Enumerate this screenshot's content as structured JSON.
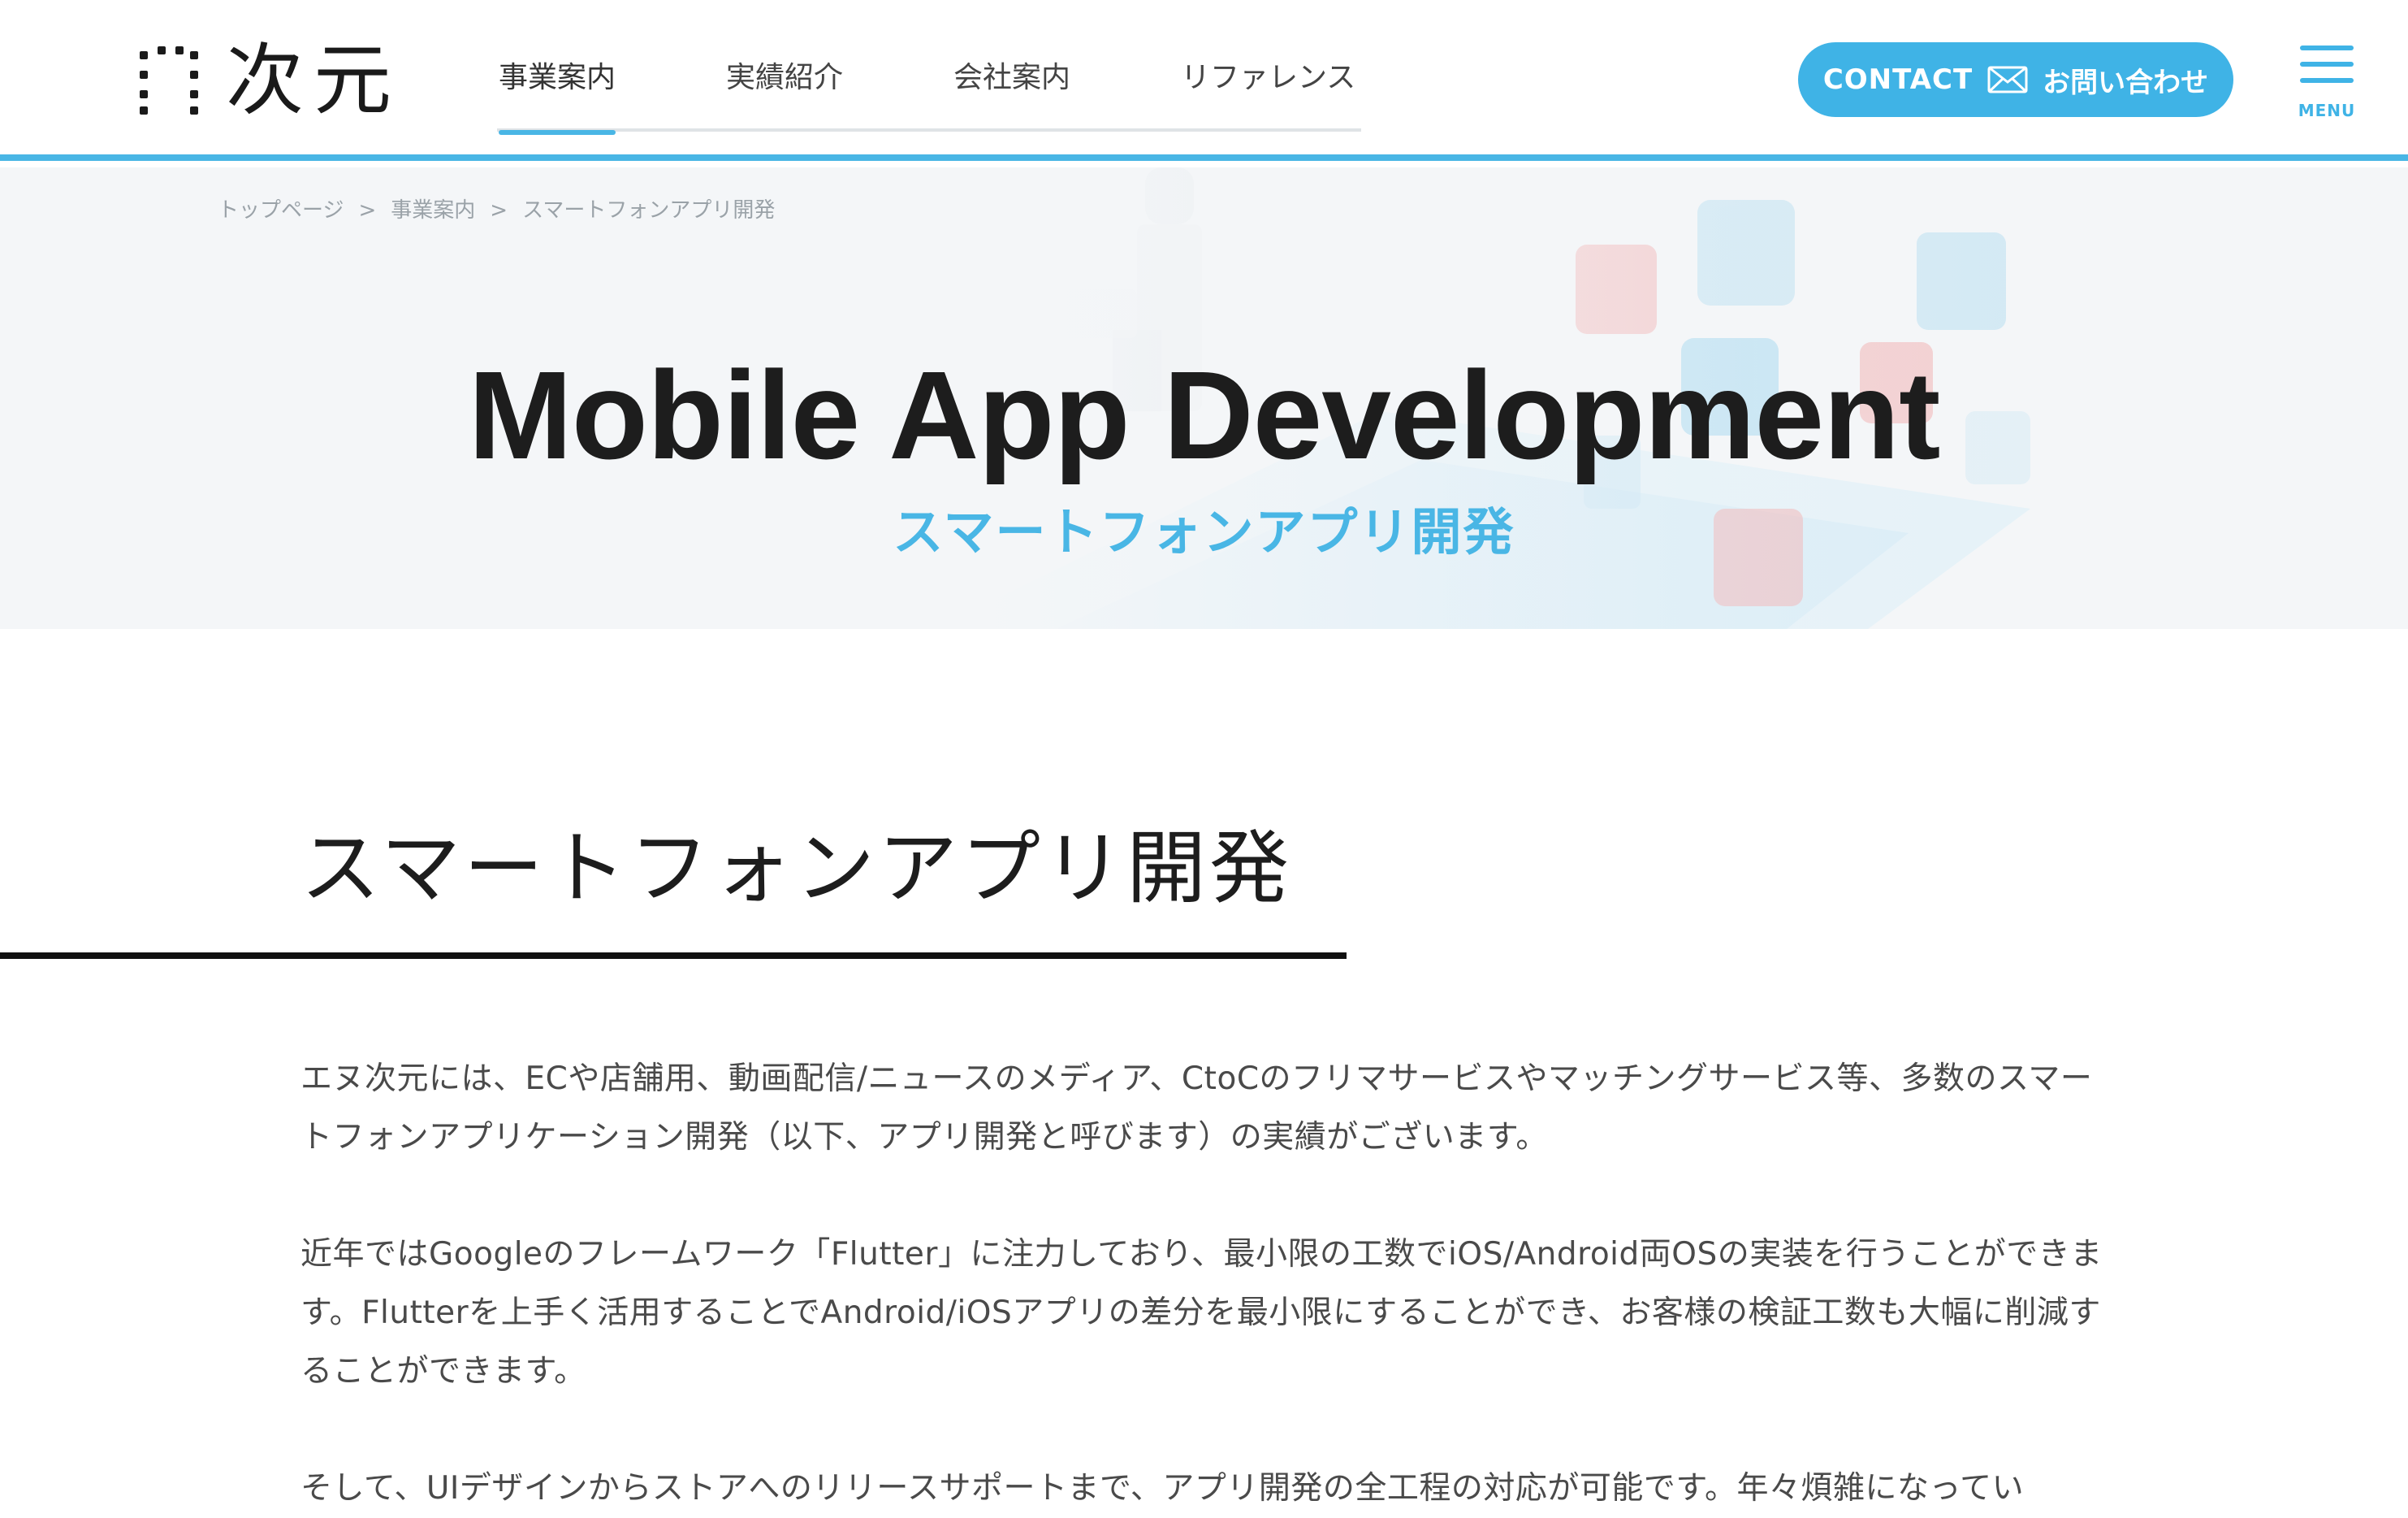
{
  "header": {
    "logo_text": "次元",
    "nav": [
      {
        "label": "事業案内",
        "active": true
      },
      {
        "label": "実績紹介",
        "active": false
      },
      {
        "label": "会社案内",
        "active": false
      },
      {
        "label": "リファレンス",
        "active": false
      }
    ],
    "contact": {
      "label_en": "CONTACT",
      "icon": "mail-icon",
      "label_ja": "お問い合わせ"
    },
    "menu_label": "MENU"
  },
  "breadcrumb": [
    "トップページ",
    "事業案内",
    "スマートフォンアプリ開発"
  ],
  "breadcrumb_separator": ">",
  "hero": {
    "title": "Mobile App Development",
    "subtitle": "スマートフォンアプリ開発"
  },
  "section": {
    "heading": "スマートフォンアプリ開発",
    "paragraphs": [
      "エヌ次元には、ECや店舗用、動画配信/ニュースのメディア、CtoCのフリマサービスやマッチングサービス等、多数のスマートフォンアプリケーション開発（以下、アプリ開発と呼びます）の実績がございます。",
      "近年ではGoogleのフレームワーク「Flutter」に注力しており、最小限の工数でiOS/Android両OSの実装を行うことができます。Flutterを上手く活用することでAndroid/iOSアプリの差分を最小限にすることができ、お客様の検証工数も大幅に削減することができます。",
      "そして、UIデザインからストアへのリリースサポートまで、アプリ開発の全工程の対応が可能です。年々煩雑になってい"
    ]
  },
  "colors": {
    "accent": "#49b6e5",
    "button": "#3fb3e6",
    "text": "#1d1d1d",
    "body_text": "#4a4a4a",
    "hero_bg": "#f4f6f8"
  }
}
